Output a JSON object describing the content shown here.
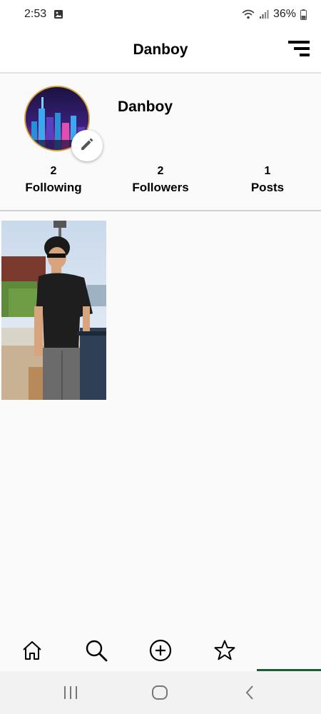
{
  "status_bar": {
    "time": "2:53",
    "battery": "36%",
    "icons": [
      "gallery-notification-icon",
      "wifi-icon",
      "signal-icon",
      "battery-icon"
    ]
  },
  "header": {
    "title": "Danboy",
    "menu_icon": "sort-menu-icon"
  },
  "profile": {
    "name": "Danboy",
    "avatar_icon": "city-skyline-avatar",
    "edit_icon": "pencil-icon",
    "avatar_border_color": "#d4a33a",
    "stats": [
      {
        "count": "2",
        "label": "Following"
      },
      {
        "count": "2",
        "label": "Followers"
      },
      {
        "count": "1",
        "label": "Posts"
      }
    ]
  },
  "posts": [
    {
      "image": "photo-person-with-sunglasses"
    }
  ],
  "bottom_nav": {
    "items": [
      "home-icon",
      "search-icon",
      "add-circle-icon",
      "star-icon"
    ],
    "indicator_color": "#1e5a35"
  },
  "system_nav": {
    "items": [
      "recent-apps-icon",
      "home-circle-icon",
      "back-chevron-icon"
    ]
  }
}
